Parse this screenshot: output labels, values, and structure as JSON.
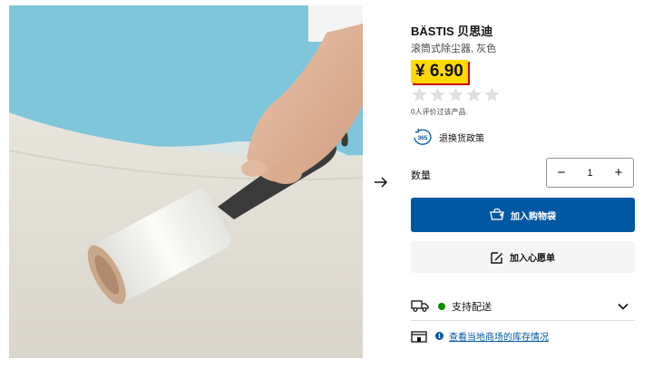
{
  "product": {
    "name": "BÄSTIS 贝思迪",
    "description": "滚筒式除尘器, 灰色",
    "price": "¥ 6.90",
    "rating": {
      "stars": 0,
      "max": 5,
      "reviews_text": "0人评价过该产品."
    },
    "returns_badge": "365",
    "returns_link": "退换货政策"
  },
  "gallery": {
    "image": "lint-roller-product-photo",
    "next_icon": "arrow-right-icon"
  },
  "quantity": {
    "label": "数量",
    "value": "1",
    "decrement": "−",
    "increment": "+"
  },
  "actions": {
    "add_to_cart": "加入购物袋",
    "add_to_wishlist": "加入心愿单"
  },
  "availability": {
    "delivery_label": "支持配送",
    "delivery_status_color": "#0a8a00",
    "store_info_icon": "i",
    "store_link": "查看当地商场的库存情况"
  },
  "colors": {
    "price_bg": "#ffdb00",
    "primary": "#0058a3"
  }
}
